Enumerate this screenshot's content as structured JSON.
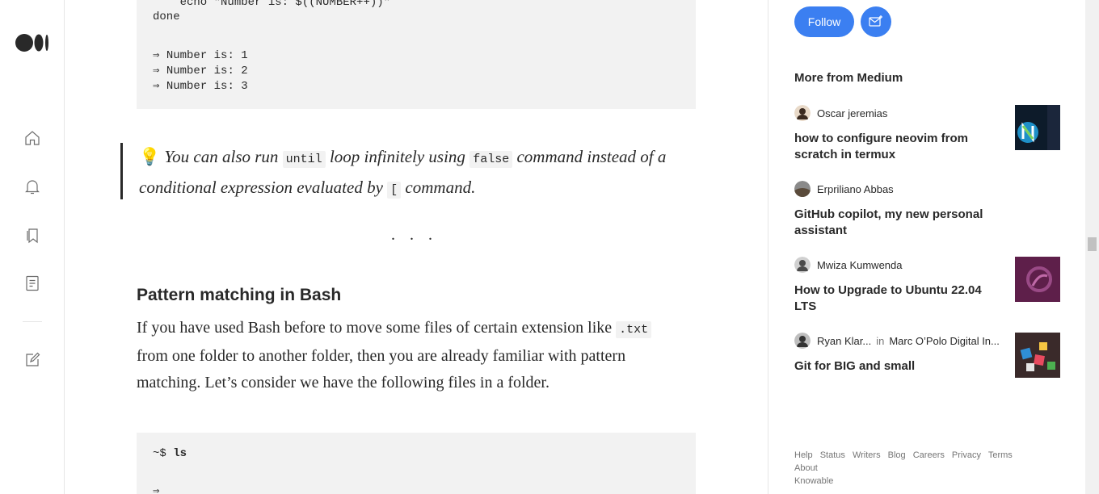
{
  "code_top": {
    "lines": [
      "    echo \"Number is: $((NUMBER++))\"",
      "done",
      "",
      "⇒ Number is: 1",
      "⇒ Number is: 2",
      "⇒ Number is: 3"
    ]
  },
  "callout": {
    "icon": "lightbulb-icon",
    "text_1": "You can also run",
    "code_1": "until",
    "text_2": "loop infinitely using",
    "code_2": "false",
    "text_3": "command instead of a conditional expression evaluated by",
    "code_3": "[",
    "text_4": "command."
  },
  "separator": "...",
  "section": {
    "heading": "Pattern matching in Bash",
    "para_1": "If you have used Bash before to move some files of certain extension like",
    "para_code": ".txt",
    "para_2": "from one folder to another folder, then you are already familiar with pattern matching. Let’s consider we have the following files in a folder."
  },
  "code_bottom": {
    "prompt": "~$",
    "command": "ls",
    "arrow": "⇒"
  },
  "sidebar": {
    "follow_label": "Follow",
    "more_title": "More from Medium",
    "items": [
      {
        "author": "Oscar jeremias",
        "publication": "",
        "title": "how to configure neovim from scratch in termux"
      },
      {
        "author": "Erpriliano Abbas",
        "publication": "",
        "title": "GitHub copilot, my new personal assistant"
      },
      {
        "author": "Mwiza Kumwenda",
        "publication": "",
        "title": "How to Upgrade to Ubuntu 22.04 LTS"
      },
      {
        "author": "Ryan Klar...",
        "in_label": "in",
        "publication": "Marc O’Polo Digital In...",
        "title": "Git for BIG and small"
      }
    ],
    "footer_links": [
      "Help",
      "Status",
      "Writers",
      "Blog",
      "Careers",
      "Privacy",
      "Terms",
      "About",
      "Knowable"
    ]
  },
  "colors": {
    "accent": "#3b7ff1",
    "text": "#292929",
    "muted": "#757575",
    "code_bg": "#f2f2f2"
  }
}
